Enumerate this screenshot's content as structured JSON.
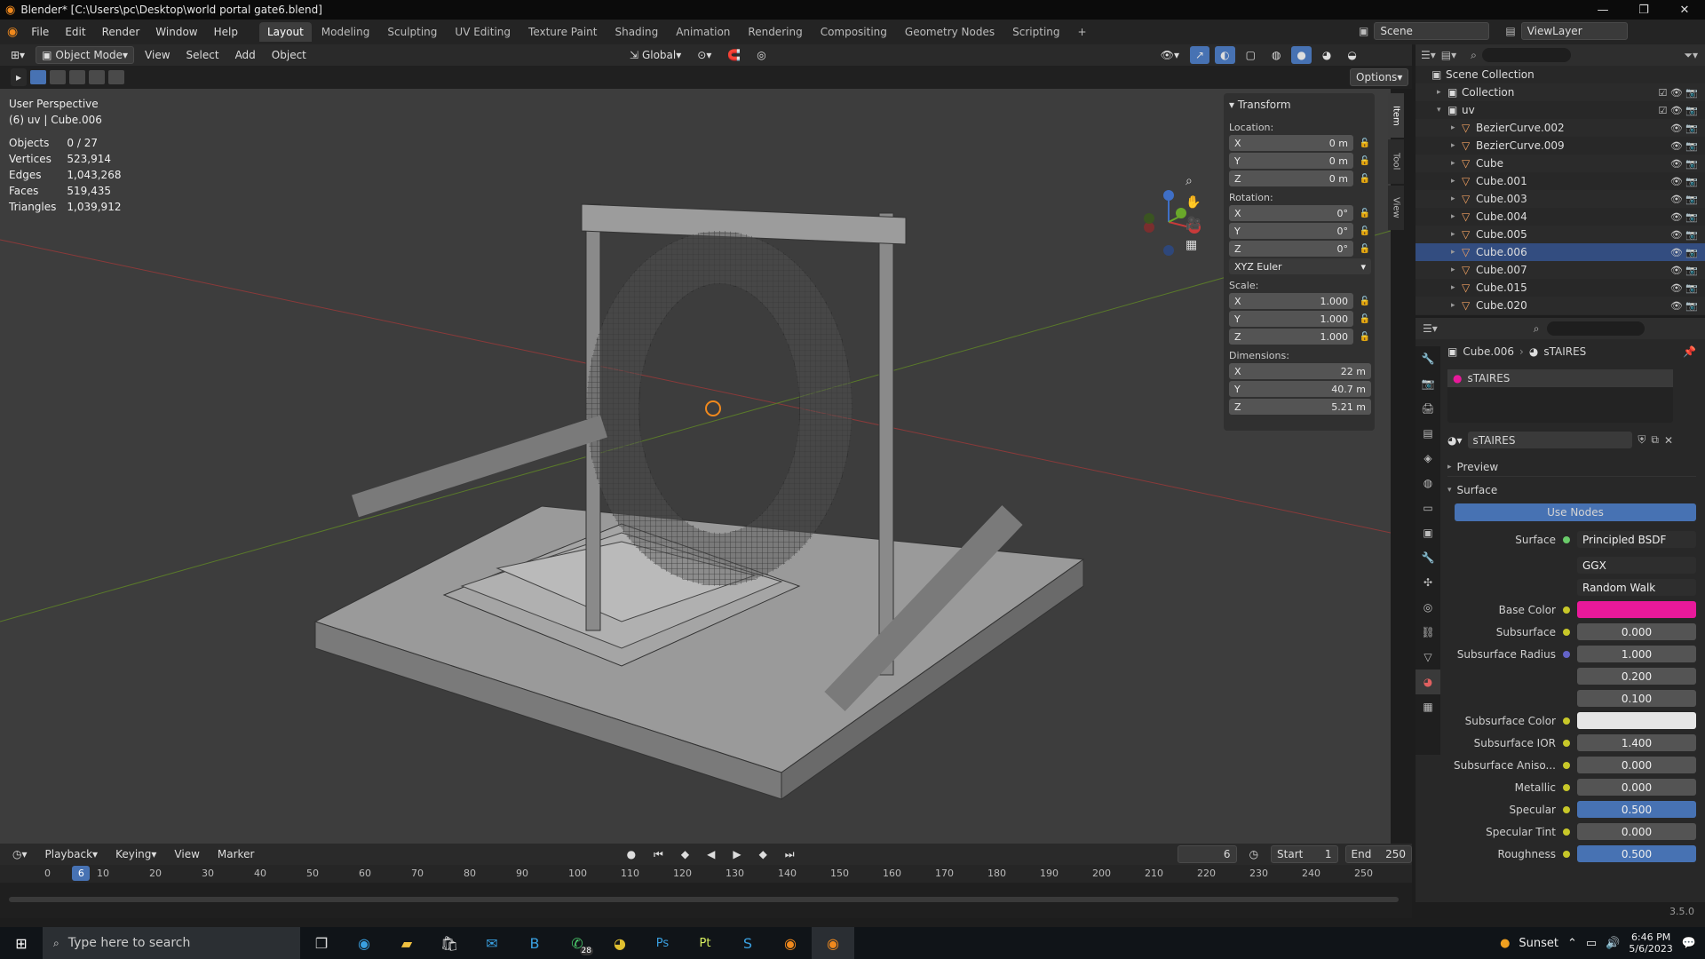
{
  "window": {
    "title": "Blender* [C:\\Users\\pc\\Desktop\\world portal gate6.blend]",
    "controls": [
      "—",
      "❐",
      "✕"
    ]
  },
  "menu": [
    "File",
    "Edit",
    "Render",
    "Window",
    "Help"
  ],
  "workspaces": [
    "Layout",
    "Modeling",
    "Sculpting",
    "UV Editing",
    "Texture Paint",
    "Shading",
    "Animation",
    "Rendering",
    "Compositing",
    "Geometry Nodes",
    "Scripting"
  ],
  "scene": {
    "label": "Scene",
    "viewlayer": "ViewLayer"
  },
  "header3d": {
    "mode": "Object Mode",
    "view": "View",
    "select": "Select",
    "add": "Add",
    "object": "Object",
    "orientation": "Global",
    "options": "Options"
  },
  "viewport": {
    "perspective": "User Perspective",
    "context": "(6) uv | Cube.006",
    "stats": [
      {
        "label": "Objects",
        "value": "0 / 27"
      },
      {
        "label": "Vertices",
        "value": "523,914"
      },
      {
        "label": "Edges",
        "value": "1,043,268"
      },
      {
        "label": "Faces",
        "value": "519,435"
      },
      {
        "label": "Triangles",
        "value": "1,039,912"
      }
    ]
  },
  "npanel": {
    "title": "Transform",
    "location_label": "Location:",
    "location": [
      {
        "axis": "X",
        "value": "0 m"
      },
      {
        "axis": "Y",
        "value": "0 m"
      },
      {
        "axis": "Z",
        "value": "0 m"
      }
    ],
    "rotation_label": "Rotation:",
    "rotation": [
      {
        "axis": "X",
        "value": "0°"
      },
      {
        "axis": "Y",
        "value": "0°"
      },
      {
        "axis": "Z",
        "value": "0°"
      }
    ],
    "rotation_mode": "XYZ Euler",
    "scale_label": "Scale:",
    "scale": [
      {
        "axis": "X",
        "value": "1.000"
      },
      {
        "axis": "Y",
        "value": "1.000"
      },
      {
        "axis": "Z",
        "value": "1.000"
      }
    ],
    "dimensions_label": "Dimensions:",
    "dimensions": [
      {
        "axis": "X",
        "value": "22 m"
      },
      {
        "axis": "Y",
        "value": "40.7 m"
      },
      {
        "axis": "Z",
        "value": "5.21 m"
      }
    ],
    "tabs": [
      "Item",
      "Tool",
      "View"
    ]
  },
  "outliner": {
    "root": "Scene Collection",
    "items": [
      {
        "name": "Collection"
      },
      {
        "name": "uv"
      },
      {
        "name": "BezierCurve.002"
      },
      {
        "name": "BezierCurve.009"
      },
      {
        "name": "Cube"
      },
      {
        "name": "Cube.001"
      },
      {
        "name": "Cube.003"
      },
      {
        "name": "Cube.004"
      },
      {
        "name": "Cube.005"
      },
      {
        "name": "Cube.006"
      },
      {
        "name": "Cube.007"
      },
      {
        "name": "Cube.015"
      },
      {
        "name": "Cube.020"
      }
    ]
  },
  "properties": {
    "breadcrumb_object": "Cube.006",
    "breadcrumb_material": "sTAIRES",
    "slot": "sTAIRES",
    "material_name": "sTAIRES",
    "preview": "Preview",
    "surface_section": "Surface",
    "use_nodes": "Use Nodes",
    "surface_label": "Surface",
    "surface_value": "Principled BSDF",
    "distribution": "GGX",
    "subsurface_method": "Random Walk",
    "rows": [
      {
        "label": "Base Color",
        "value": "",
        "color": "#e8199a"
      },
      {
        "label": "Subsurface",
        "value": "0.000"
      },
      {
        "label": "Subsurface Radius",
        "value": "1.000"
      },
      {
        "label": "",
        "value": "0.200"
      },
      {
        "label": "",
        "value": "0.100"
      },
      {
        "label": "Subsurface Color",
        "value": "",
        "color": "#e6e6e6"
      },
      {
        "label": "Subsurface IOR",
        "value": "1.400"
      },
      {
        "label": "Subsurface Aniso...",
        "value": "0.000"
      },
      {
        "label": "Metallic",
        "value": "0.000"
      },
      {
        "label": "Specular",
        "value": "0.500"
      },
      {
        "label": "Specular Tint",
        "value": "0.000"
      },
      {
        "label": "Roughness",
        "value": "0.500"
      }
    ],
    "version": "3.5.0"
  },
  "timeline": {
    "playback": "Playback",
    "keying": "Keying",
    "view": "View",
    "marker": "Marker",
    "current_frame": "6",
    "start_label": "Start",
    "start": "1",
    "end_label": "End",
    "end": "250",
    "ticks": [
      "0",
      "10",
      "20",
      "30",
      "40",
      "50",
      "60",
      "70",
      "80",
      "90",
      "100",
      "110",
      "120",
      "130",
      "140",
      "150",
      "160",
      "170",
      "180",
      "190",
      "200",
      "210",
      "220",
      "230",
      "240",
      "250"
    ]
  },
  "taskbar": {
    "search_placeholder": "Type here to search",
    "weather": "Sunset",
    "time": "6:46 PM",
    "date": "5/6/2023",
    "whatsapp_badge": "28"
  },
  "colors": {
    "accent": "#4772b3",
    "base_color": "#e8199a",
    "orange": "#f0891d"
  }
}
